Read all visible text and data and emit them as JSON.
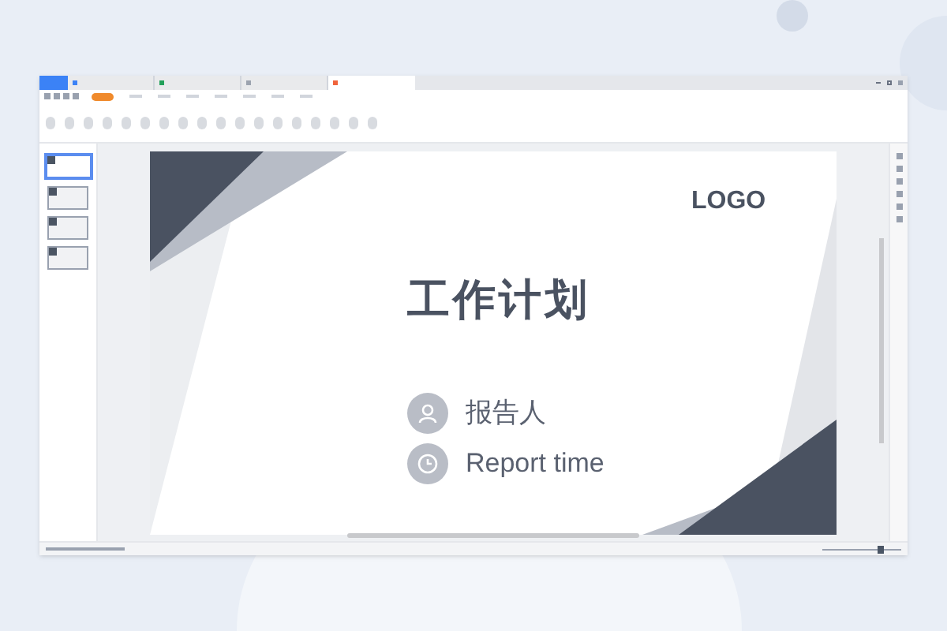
{
  "window": {
    "tabs": [
      {
        "color": "#3b82f6",
        "selected": false
      },
      {
        "color": "#3b82f6",
        "selected": false
      },
      {
        "color": "#22a05a",
        "selected": false
      },
      {
        "color": "#9ca3af",
        "selected": false
      },
      {
        "color": "#f0643c",
        "selected": true
      }
    ]
  },
  "menu": {
    "items": [
      {
        "selected": true
      },
      {
        "selected": false
      },
      {
        "selected": false
      },
      {
        "selected": false
      },
      {
        "selected": false
      },
      {
        "selected": false
      },
      {
        "selected": false
      },
      {
        "selected": false
      }
    ]
  },
  "zoom": {
    "level": 0.75
  },
  "thumbnails": [
    {
      "selected": true
    },
    {
      "selected": false
    },
    {
      "selected": false
    },
    {
      "selected": false
    }
  ],
  "slide": {
    "logo": "LOGO",
    "title": "工作计划",
    "items": [
      {
        "kind": "person",
        "text": "报告人"
      },
      {
        "kind": "clock",
        "text": "Report time"
      }
    ]
  }
}
